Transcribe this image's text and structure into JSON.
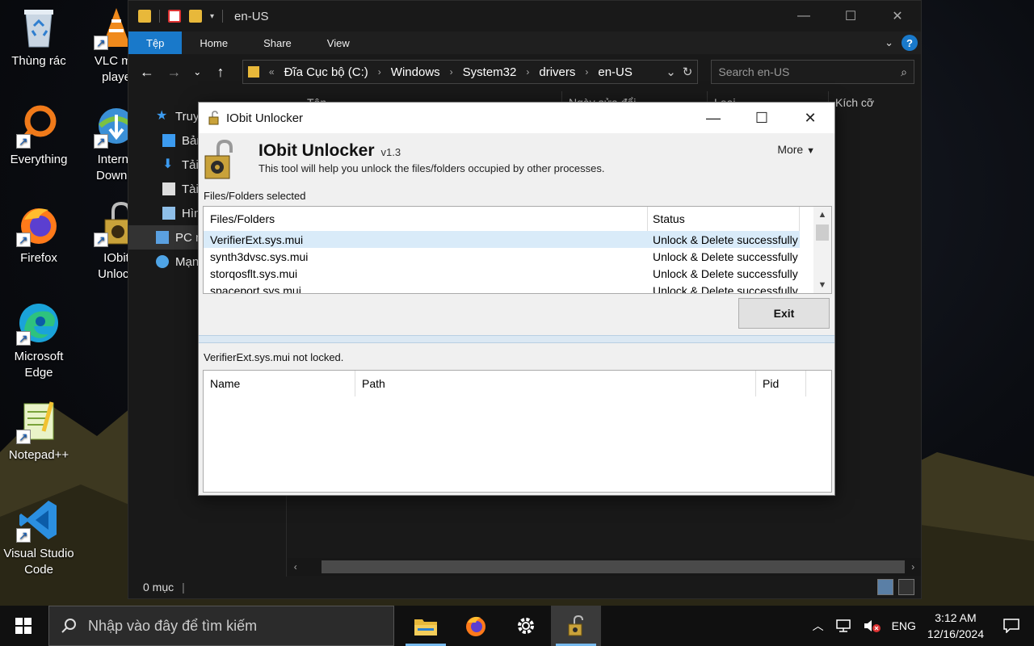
{
  "desktop": {
    "icons": [
      {
        "label": "Thùng rác"
      },
      {
        "label": "VLC me\nplaye"
      },
      {
        "label": "Everything"
      },
      {
        "label": "Interne\nDownlo"
      },
      {
        "label": "Firefox"
      },
      {
        "label": "IObit\nUnlock"
      },
      {
        "label": "Microsoft\nEdge"
      },
      {
        "label": "Notepad++"
      },
      {
        "label": "Visual Studio\nCode"
      }
    ]
  },
  "explorer": {
    "title": "en-US",
    "ribbon_tabs": [
      "Tệp",
      "Home",
      "Share",
      "View"
    ],
    "address_path": [
      "Đĩa Cục bộ (C:)",
      "Windows",
      "System32",
      "drivers",
      "en-US"
    ],
    "search_placeholder": "Search en-US",
    "nav_items": [
      "Truy",
      "Bản",
      "Tải",
      "Tài",
      "Hìn",
      "PC n",
      "Mạn"
    ],
    "columns": [
      "Tên",
      "Ngày sửa đổi",
      "Loại",
      "Kích cỡ"
    ],
    "status": "0 mục"
  },
  "dialog": {
    "window_title": "IObit Unlocker",
    "app_name": "IObit Unlocker",
    "version": "v1.3",
    "subtitle": "This tool will help you unlock the files/folders occupied by other processes.",
    "more_label": "More",
    "section_label": "Files/Folders selected",
    "file_columns": [
      "Files/Folders",
      "Status"
    ],
    "files": [
      {
        "name": "VerifierExt.sys.mui",
        "status": "Unlock & Delete successfully"
      },
      {
        "name": "synth3dvsc.sys.mui",
        "status": "Unlock & Delete successfully"
      },
      {
        "name": "storqosflt.sys.mui",
        "status": "Unlock & Delete successfully"
      },
      {
        "name": "spaceport.sys.mui",
        "status": "Unlock & Delete successfully"
      }
    ],
    "exit_label": "Exit",
    "lock_status": "VerifierExt.sys.mui not locked.",
    "process_columns": [
      "Name",
      "Path",
      "Pid"
    ]
  },
  "taskbar": {
    "search_placeholder": "Nhập vào đây để tìm kiếm",
    "language": "ENG",
    "time": "3:12 AM",
    "date": "12/16/2024"
  },
  "colors": {
    "accent": "#1979ca",
    "selection": "#d9ebf9"
  }
}
